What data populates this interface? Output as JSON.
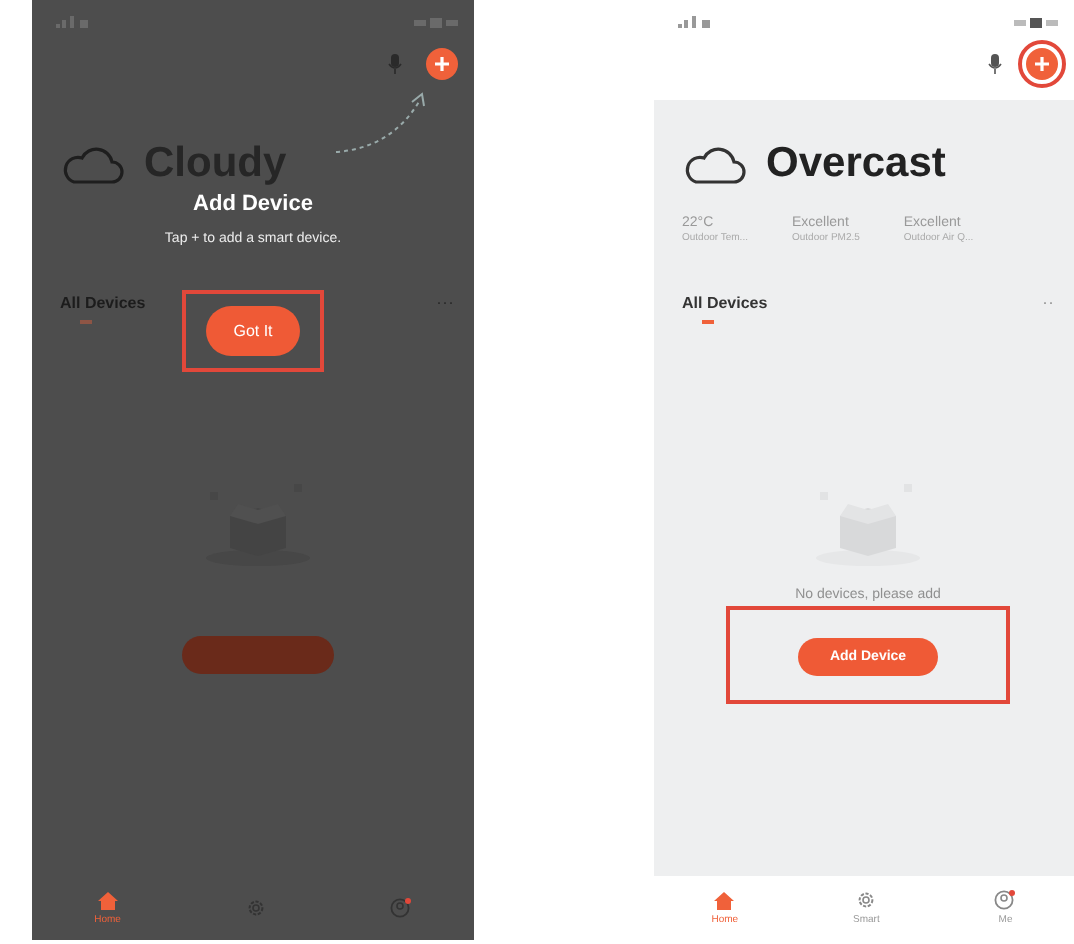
{
  "screens": [
    {
      "dimmed": true,
      "plus_highlighted": false,
      "add_highlighted": false,
      "weather": "Cloudy",
      "section": "All Devices",
      "more": "···",
      "tabs": [
        {
          "label": "Home",
          "selected": true
        },
        {
          "selected": false
        },
        {
          "selected": false
        }
      ],
      "overlay": {
        "title": "Add Device",
        "hint": "Tap + to add a smart device.",
        "button": "Got It",
        "button_highlighted": true
      }
    },
    {
      "dimmed": false,
      "plus_highlighted": true,
      "add_highlighted": true,
      "weather": "Overcast",
      "stats": [
        {
          "value": "22°C",
          "label": "Outdoor Tem..."
        },
        {
          "value": "Excellent",
          "label": "Outdoor PM2.5"
        },
        {
          "value": "Excellent",
          "label": "Outdoor Air Q..."
        }
      ],
      "section": "All Devices",
      "more": "··",
      "empty_text": "No devices, please add",
      "add_button": "Add Device",
      "tabs": [
        {
          "label": "Home",
          "selected": true
        },
        {
          "label": "Smart",
          "selected": false
        },
        {
          "label": "Me",
          "selected": false
        }
      ]
    }
  ]
}
